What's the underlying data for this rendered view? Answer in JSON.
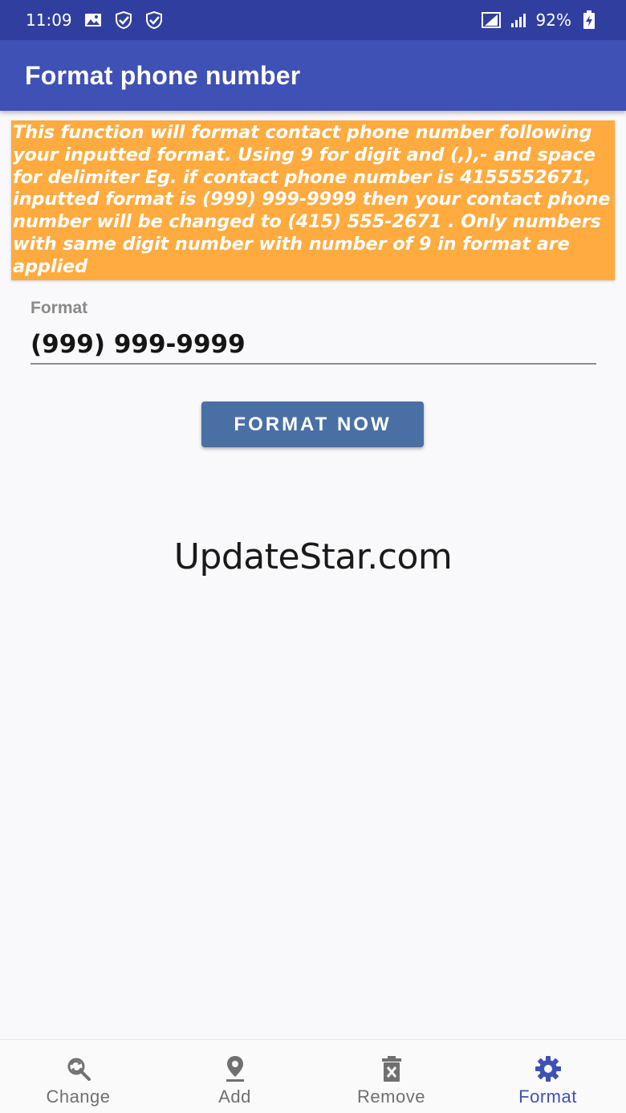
{
  "status_bar": {
    "time": "11:09",
    "battery": "92%",
    "icons": [
      "image-icon",
      "shield-check-icon",
      "shield-check-icon",
      "signal-wifi-icon",
      "signal-bars-icon",
      "battery-charging-icon"
    ]
  },
  "app_bar": {
    "title": "Format phone number"
  },
  "info": {
    "text": "This function will format contact phone number following your inputted format. Using 9 for digit and (,),- and space for delimiter Eg. if contact phone number is 4155552671, inputted format is (999) 999-9999 then your contact phone number will be changed to (415) 555-2671 . Only numbers with same digit number with number of 9 in format are applied"
  },
  "format_field": {
    "label": "Format",
    "value": "(999) 999-9999"
  },
  "format_button": {
    "label": "FORMAT NOW"
  },
  "watermark": "UpdateStar.com",
  "bottom_nav": {
    "items": [
      {
        "label": "Change",
        "icon": "search-refresh-icon",
        "active": false
      },
      {
        "label": "Add",
        "icon": "location-pin-icon",
        "active": false
      },
      {
        "label": "Remove",
        "icon": "delete-icon",
        "active": false
      },
      {
        "label": "Format",
        "icon": "gear-icon",
        "active": true
      }
    ]
  },
  "colors": {
    "status_bar": "#303f9f",
    "app_bar": "#3f51b5",
    "info_box": "#ffab40",
    "button": "#4a6fa5",
    "nav_active": "#3f51b5",
    "nav_inactive": "#707070"
  }
}
